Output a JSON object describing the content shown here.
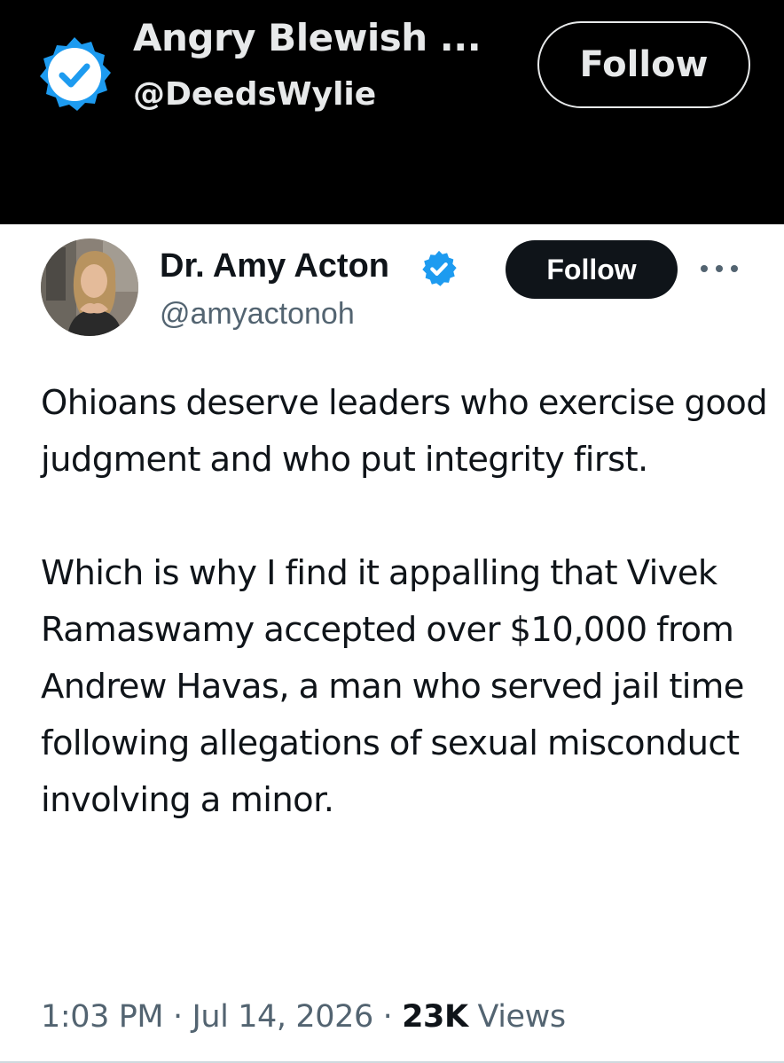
{
  "header": {
    "display_name": "Angry Blewish ...",
    "handle": "@DeedsWylie",
    "follow_label": "Follow",
    "verified_icon": "verified-badge-icon"
  },
  "tweet": {
    "author": {
      "display_name": "Dr. Amy Acton",
      "handle": "@amyactonoh",
      "verified_icon": "verified-badge-icon",
      "avatar": "avatar-photo"
    },
    "follow_label": "Follow",
    "more_icon": "more-options-icon",
    "paragraphs": [
      "Ohioans deserve leaders who exercise good judgment and who put integrity first.",
      "Which is why I find it appalling that Vivek Ramaswamy accepted over $10,000 from Andrew Havas, a man who served jail time following allegations of sexual misconduct involving a minor."
    ],
    "meta": {
      "time": "1:03 PM",
      "separator": "·",
      "date": "Jul 14, 2026",
      "views_count": "23K",
      "views_label": "Views"
    }
  },
  "colors": {
    "header_background": "#000000",
    "header_text": "#e7e9ea",
    "verified_blue": "#1d9bf0",
    "primary_text": "#0f1419",
    "secondary_text": "#536471",
    "follow_button_dark": "#0f1419"
  }
}
